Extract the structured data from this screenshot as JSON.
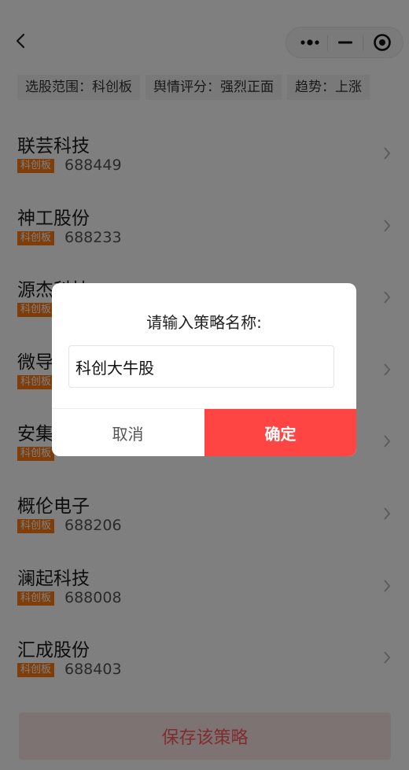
{
  "header": {
    "back_icon": "chevron-left-icon",
    "capsule_icons": [
      "more-dots-icon",
      "minimize-icon",
      "target-icon"
    ]
  },
  "filters": [
    {
      "label": "选股范围：科创板"
    },
    {
      "label": "舆情评分：强烈正面"
    },
    {
      "label": "趋势：上涨"
    }
  ],
  "stocks": [
    {
      "name": "联芸科技",
      "board": "科创板",
      "code": "688449"
    },
    {
      "name": "神工股份",
      "board": "科创板",
      "code": "688233"
    },
    {
      "name": "源杰科技",
      "board": "科创板",
      "code": ""
    },
    {
      "name": "微导",
      "board": "科创板",
      "code": ""
    },
    {
      "name": "安集",
      "board": "科创板",
      "code": ""
    },
    {
      "name": "概伦电子",
      "board": "科创板",
      "code": "688206"
    },
    {
      "name": "澜起科技",
      "board": "科创板",
      "code": "688008"
    },
    {
      "name": "汇成股份",
      "board": "科创板",
      "code": "688403"
    }
  ],
  "footer": {
    "save_label": "保存该策略"
  },
  "dialog": {
    "title": "请输入策略名称:",
    "input_value": "科创大牛股",
    "cancel_label": "取消",
    "confirm_label": "确定"
  },
  "colors": {
    "accent": "#ff4444",
    "badge": "#ff7a12",
    "save_bg": "#fde7e7",
    "save_text": "#ff5a5a"
  }
}
